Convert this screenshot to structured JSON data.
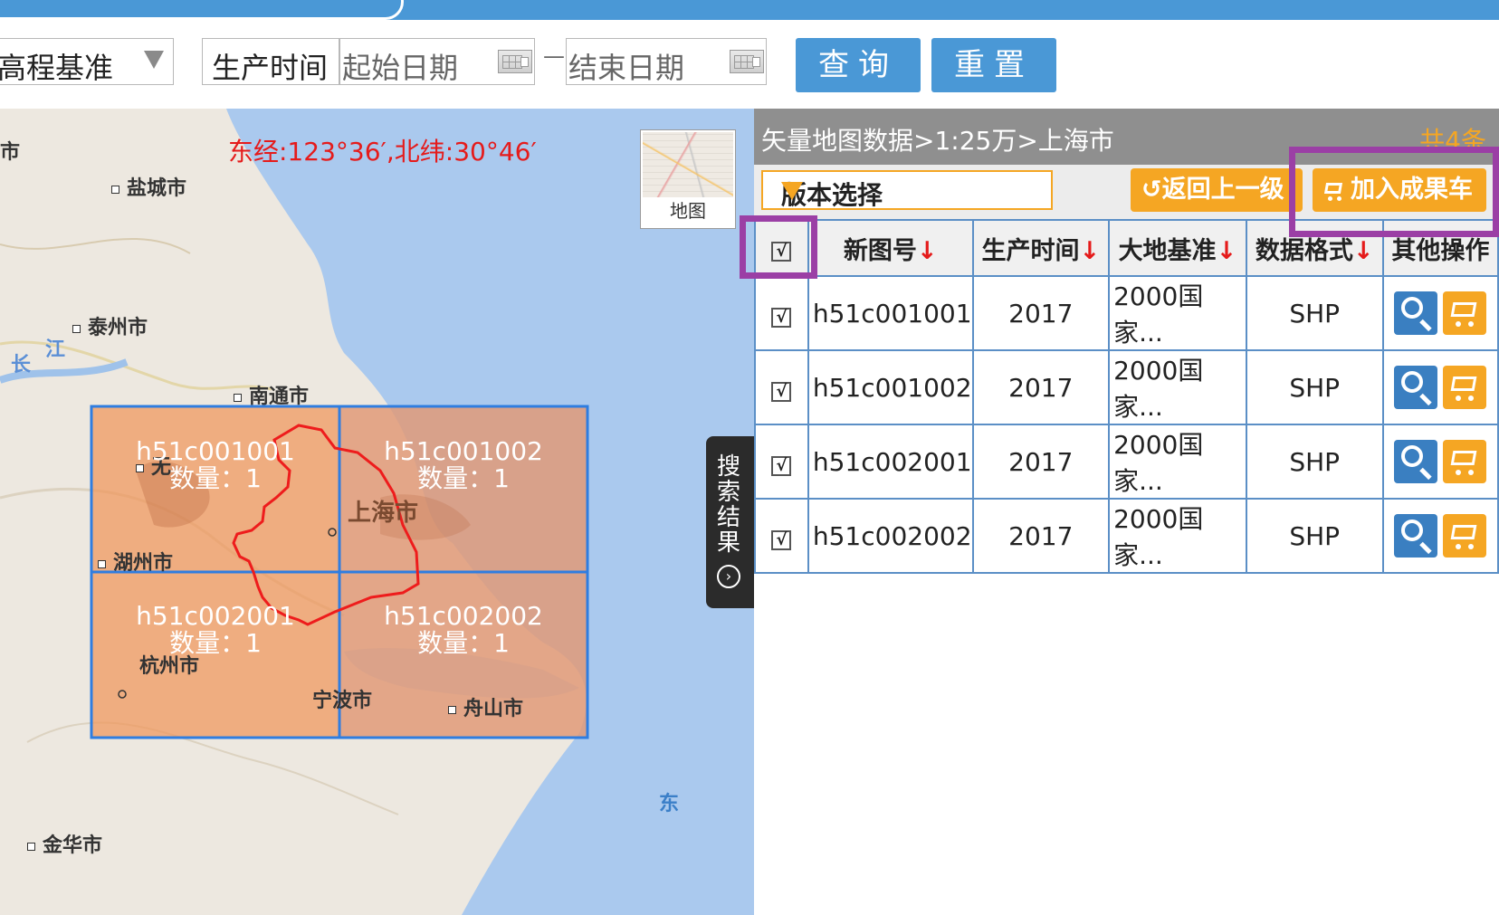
{
  "filters": {
    "datum_select_value": "高程基准",
    "time_label": "生产时间",
    "start_date_placeholder": "起始日期",
    "end_date_placeholder": "结束日期",
    "range_separator": "—",
    "query_button": "查询",
    "reset_button": "重置"
  },
  "map": {
    "coordinate_readout": "东经:123°36′,北纬:30°46′",
    "basemap_toggle_label": "地图",
    "search_results_tab": "搜索结果",
    "places": {
      "yancheng": "盐城市",
      "taizhou": "泰州市",
      "nantong": "南通市",
      "wuxi": "无",
      "shanghai": "上海市",
      "huzhou": "湖州市",
      "hangzhou": "杭州市",
      "ningbo": "宁波市",
      "zhoushan": "舟山市",
      "jinhua": "金华市",
      "chang": "长",
      "jiang": "江",
      "dong": "东",
      "shi_edge": "市"
    },
    "tiles": [
      {
        "id": "h51c001001",
        "count": "数量：1"
      },
      {
        "id": "h51c001002",
        "count": "数量：1"
      },
      {
        "id": "h51c002001",
        "count": "数量：1"
      },
      {
        "id": "h51c002002",
        "count": "数量：1"
      }
    ]
  },
  "panel": {
    "breadcrumb": "矢量地图数据>1:25万>上海市",
    "total_count": "共4条",
    "version_select": "版本选择",
    "back_button": "返回上一级",
    "add_to_cart_button": "加入成果车",
    "columns": {
      "select_all": "√",
      "map_number": "新图号",
      "production_time": "生产时间",
      "geodetic_datum": "大地基准",
      "data_format": "数据格式",
      "other_ops": "其他操作",
      "sort_arrow": "↓"
    },
    "rows": [
      {
        "check": "√",
        "map_number": "h51c001001",
        "time": "2017",
        "datum": "2000国家...",
        "format": "SHP"
      },
      {
        "check": "√",
        "map_number": "h51c001002",
        "time": "2017",
        "datum": "2000国家...",
        "format": "SHP"
      },
      {
        "check": "√",
        "map_number": "h51c002001",
        "time": "2017",
        "datum": "2000国家...",
        "format": "SHP"
      },
      {
        "check": "√",
        "map_number": "h51c002002",
        "time": "2017",
        "datum": "2000国家...",
        "format": "SHP"
      }
    ]
  },
  "colors": {
    "brand_blue": "#4a98d6",
    "accent_orange": "#f5a623",
    "highlight_purple": "#9b3fa5",
    "sea": "#aac9ee",
    "tile_fill": "#f0955a",
    "coordinate_red": "#e51b1b"
  }
}
